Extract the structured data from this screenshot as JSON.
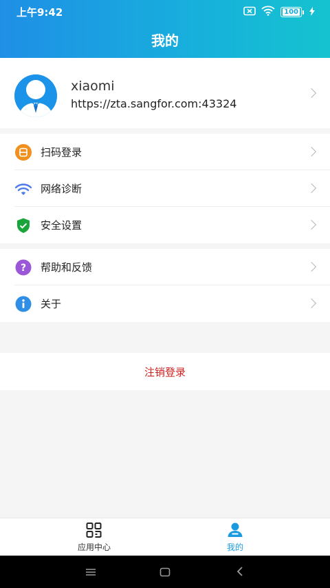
{
  "status_bar": {
    "time": "上午9:42",
    "battery": "100"
  },
  "header": {
    "title": "我的"
  },
  "profile": {
    "name": "xiaomi",
    "server": "https://zta.sangfor.com:43324"
  },
  "menu_groups": [
    [
      {
        "label": "扫码登录",
        "icon": "scan-icon",
        "color": "#f0901e"
      },
      {
        "label": "网络诊断",
        "icon": "wifi-icon",
        "color": "#4f7be8"
      },
      {
        "label": "安全设置",
        "icon": "shield-check-icon",
        "color": "#1aa53a"
      }
    ],
    [
      {
        "label": "帮助和反馈",
        "icon": "help-icon",
        "color": "#9a57d8"
      },
      {
        "label": "关于",
        "icon": "info-icon",
        "color": "#2f8ee6"
      }
    ]
  ],
  "logout": {
    "label": "注销登录",
    "color": "#d02020"
  },
  "bottom_nav": [
    {
      "label": "应用中心",
      "icon": "grid-icon",
      "active": false
    },
    {
      "label": "我的",
      "icon": "profile-icon",
      "active": true,
      "active_color": "#1a9be0"
    }
  ]
}
